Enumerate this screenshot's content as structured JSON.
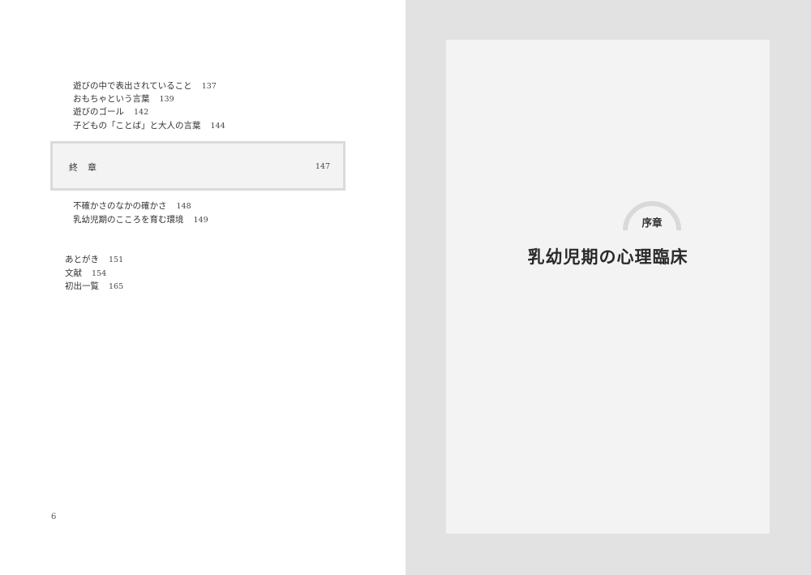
{
  "left_page": {
    "toc_group_1": [
      {
        "title": "遊びの中で表出されていること",
        "page": "137"
      },
      {
        "title": "おもちゃという言葉",
        "page": "139"
      },
      {
        "title": "遊びのゴール",
        "page": "142"
      },
      {
        "title": "子どもの「ことば」と大人の言葉",
        "page": "144"
      }
    ],
    "chapter": {
      "title": "終章",
      "page": "147"
    },
    "toc_group_2": [
      {
        "title": "不確かさのなかの確かさ",
        "page": "148"
      },
      {
        "title": "乳幼児期のこころを育む環境",
        "page": "149"
      }
    ],
    "back_matter": [
      {
        "title": "あとがき",
        "page": "151"
      },
      {
        "title": "文献",
        "page": "154"
      },
      {
        "title": "初出一覧",
        "page": "165"
      }
    ],
    "folio": "6"
  },
  "right_page": {
    "label": "序章",
    "title": "乳幼児期の心理臨床"
  },
  "colors": {
    "page_background": "#ffffff",
    "gray_margin": "#e2e2e2",
    "sheet": "#f3f3f3",
    "box_border": "#dadada",
    "arc": "#d9d9d9",
    "text": "#333333"
  }
}
